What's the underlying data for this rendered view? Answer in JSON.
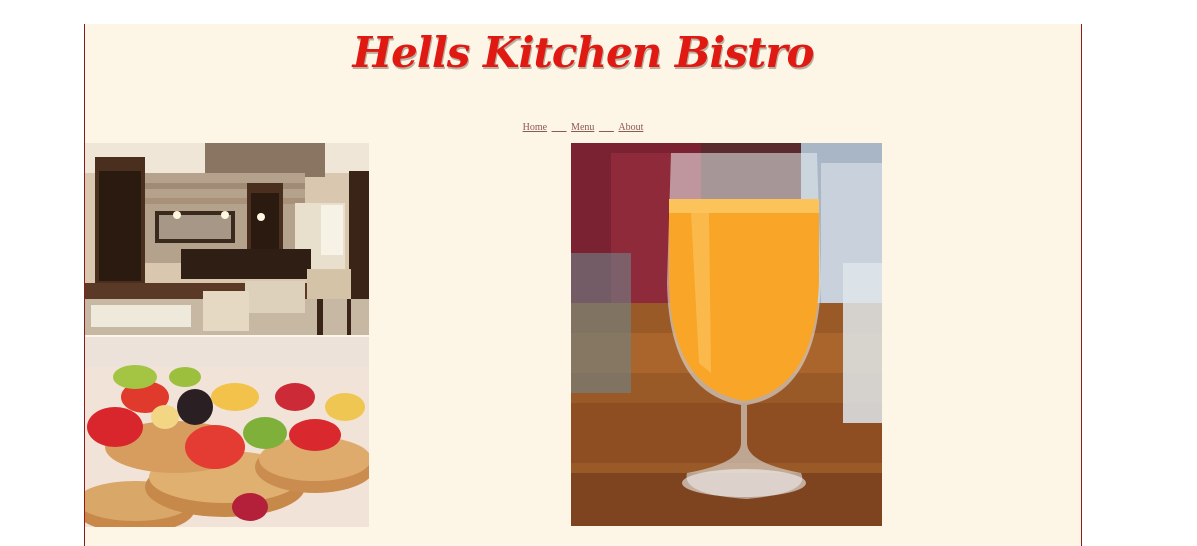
{
  "site": {
    "title": "Hells Kitchen Bistro"
  },
  "nav": {
    "items": [
      "Home",
      "Menu",
      "About"
    ]
  },
  "images": [
    {
      "name": "restaurant-interior-image"
    },
    {
      "name": "pancakes-fruit-image"
    },
    {
      "name": "orange-drink-image"
    }
  ],
  "colors": {
    "title": "#e01a12",
    "page_bg": "#fdf5e6",
    "border": "#8b1a1a",
    "nav_link": "#8a5a55"
  }
}
